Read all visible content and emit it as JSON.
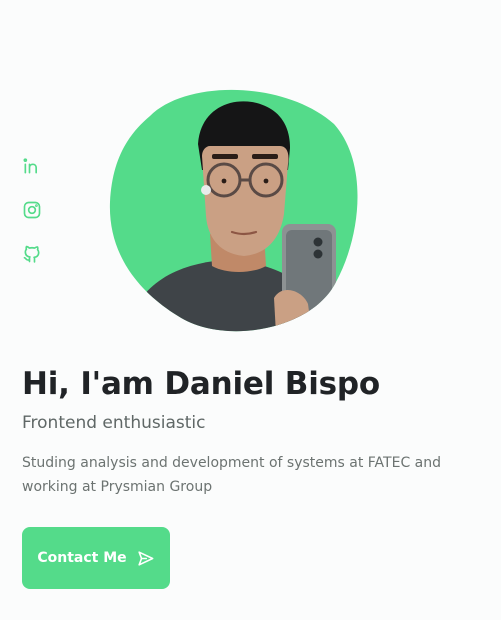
{
  "hero": {
    "name": "Hi, I'am Daniel Bispo",
    "subtitle": "Frontend enthusiastic",
    "description": "Studing analysis and development of systems at FATEC and working at Prysmian Group",
    "contact_label": "Contact Me"
  },
  "social": [
    {
      "icon": "linkedin-icon"
    },
    {
      "icon": "instagram-icon"
    },
    {
      "icon": "github-icon"
    }
  ],
  "colors": {
    "accent": "#54db8a",
    "heading": "#202326",
    "text": "#6c7371",
    "background": "#fbfcfc"
  }
}
